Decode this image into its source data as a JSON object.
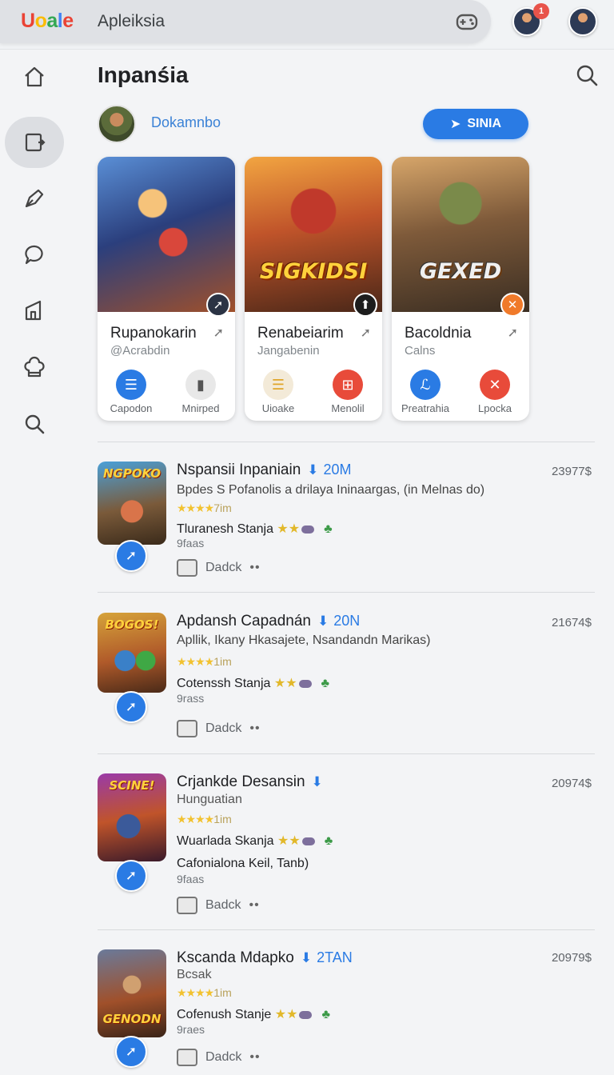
{
  "topbar": {
    "logo": [
      "U",
      "o",
      "a",
      "l",
      "e"
    ],
    "search_text": "Apleiksia",
    "notification_count": "1"
  },
  "sidebar": {
    "items": [
      {
        "icon": "home-icon"
      },
      {
        "icon": "apps-icon",
        "active": true
      },
      {
        "icon": "pen-icon"
      },
      {
        "icon": "chat-icon"
      },
      {
        "icon": "library-icon"
      },
      {
        "icon": "chef-hat-icon"
      },
      {
        "icon": "search-icon"
      }
    ]
  },
  "main": {
    "title": "Inpanśia",
    "user_name": "Dokamnbo",
    "sign_button": "SINIA"
  },
  "featured": [
    {
      "title": "Rupanokarin",
      "subtitle": "@Acrabdin",
      "art_text": "",
      "action1": "Capodon",
      "action2": "Mnirped"
    },
    {
      "title": "Renabeiarim",
      "subtitle": "Jangabenin",
      "art_text": "SIGKIDSI",
      "action1": "Uioake",
      "action2": "Menolil"
    },
    {
      "title": "Bacoldnia",
      "subtitle": "Calns",
      "art_text": "GEXED",
      "action1": "Preatrahia",
      "action2": "Lpocka"
    }
  ],
  "list": [
    {
      "thumb_text": "NGPOKO",
      "title": "Nspansii Inpaniain",
      "downloads": "20M",
      "desc": "Bpdes S Pofanolis a drilaya Ininaargas, (in Melnas do)",
      "rating_text": "7im",
      "studio": "Tluranesh Stanja",
      "meta": "9faas",
      "badge": "Dadck",
      "num": "23977$"
    },
    {
      "thumb_text": "BOGOS!",
      "title": "Apdansh Capadnán",
      "downloads": "20N",
      "desc": "Apllik, Ikany Hkasajete, Nsandandn Marikas)",
      "rating_text": "1im",
      "studio": "Cotenssh Stanja",
      "meta": "9rass",
      "badge": "Dadck",
      "num": "21674$"
    },
    {
      "thumb_text": "SCINE!",
      "title": "Crjankde Desansin",
      "downloads": "",
      "desc": "Hunguatian",
      "rating_text": "1im",
      "studio": "Wuarlada Skanja",
      "extra": "Cafonialona Keil, Tanb)",
      "meta": "9faas",
      "badge": "Badck",
      "num": "20974$"
    },
    {
      "thumb_text": "GENODN",
      "title": "Kscanda Mdapko",
      "downloads": "2TAN",
      "desc": "Bcsak",
      "rating_text": "1im",
      "studio": "Cofenush Stanje",
      "meta": "9raes",
      "badge": "Dadck",
      "num": "20979$"
    }
  ]
}
